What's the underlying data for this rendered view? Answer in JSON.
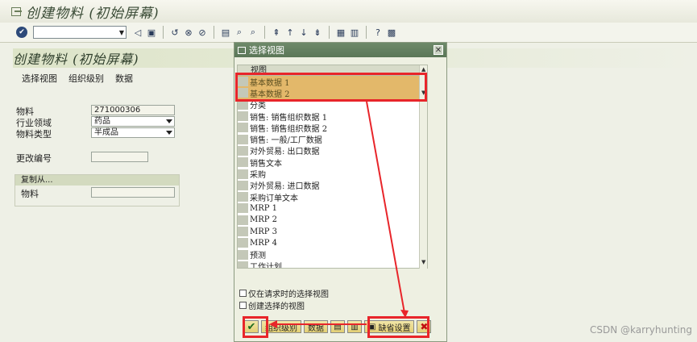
{
  "window": {
    "title": "创建物料 (初始屏幕)"
  },
  "toolbar": {
    "command_value": "",
    "icons": [
      "enter-icon",
      "save-icon",
      "back-icon",
      "exit-icon",
      "cancel-icon",
      "print-icon",
      "find-icon",
      "find-next-icon",
      "first-page-icon",
      "prev-page-icon",
      "next-page-icon",
      "last-page-icon",
      "new-session-icon",
      "shortcut-icon",
      "help-icon",
      "layout-icon"
    ]
  },
  "screen": {
    "title": "创建物料 (初始屏幕)",
    "app_toolbar": [
      "选择视图",
      "组织级别",
      "数据"
    ],
    "fields": [
      {
        "label": "物料",
        "value": "271000306",
        "type": "text"
      },
      {
        "label": "行业领域",
        "value": "药品",
        "type": "dropdown"
      },
      {
        "label": "物料类型",
        "value": "半成品",
        "type": "dropdown"
      }
    ],
    "change_number": {
      "label": "更改编号",
      "value": ""
    },
    "copy_from": {
      "header": "复制从...",
      "label": "物料",
      "value": ""
    }
  },
  "dialog": {
    "title": "选择视图",
    "column_header": "视图",
    "views": [
      {
        "label": "基本数据 1",
        "selected": true
      },
      {
        "label": "基本数据 2",
        "selected": true
      },
      {
        "label": "分类",
        "selected": false
      },
      {
        "label": "销售: 销售组织数据 1",
        "selected": false
      },
      {
        "label": "销售: 销售组织数据 2",
        "selected": false
      },
      {
        "label": "销售: 一般/工厂数据",
        "selected": false
      },
      {
        "label": "对外贸易: 出口数据",
        "selected": false
      },
      {
        "label": "销售文本",
        "selected": false
      },
      {
        "label": "采购",
        "selected": false
      },
      {
        "label": "对外贸易: 进口数据",
        "selected": false
      },
      {
        "label": "采购订单文本",
        "selected": false
      },
      {
        "label": "MRP 1",
        "selected": false
      },
      {
        "label": "MRP 2",
        "selected": false
      },
      {
        "label": "MRP 3",
        "selected": false
      },
      {
        "label": "MRP 4",
        "selected": false
      },
      {
        "label": "预测",
        "selected": false
      },
      {
        "label": "工作计划",
        "selected": false
      }
    ],
    "options": [
      {
        "label": "仅在请求时的选择视图",
        "checked": false
      },
      {
        "label": "创建选择的视图",
        "checked": false
      }
    ],
    "buttons": {
      "org_levels": "组织级别",
      "data": "数据",
      "default_settings": "缺省设置"
    }
  },
  "colors": {
    "annotation": "#e8252a",
    "selected_row": "#e3b86a",
    "dialog_title": "#5a7657"
  },
  "watermark": "CSDN @karryhunting"
}
